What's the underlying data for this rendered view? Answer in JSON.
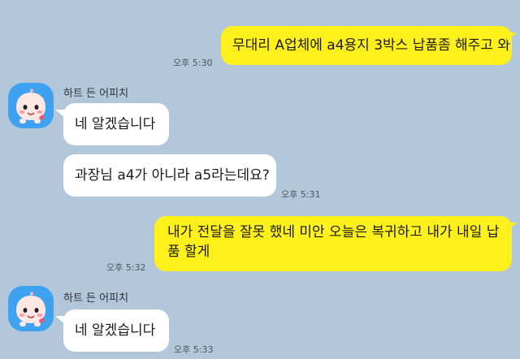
{
  "chat": {
    "messages": [
      {
        "side": "me",
        "text": "무대리 A업체에 a4용지 3박스 납품좀 해주고 와",
        "time": "오후 5:30"
      },
      {
        "side": "them",
        "sender": "하트 든 어피치",
        "avatar_icon": "apeach-character-icon",
        "text": "네 알겠습니다"
      },
      {
        "side": "them",
        "text": "과장님 a4가 아니라 a5라는데요?",
        "time": "오후 5:31"
      },
      {
        "side": "me",
        "text": "내가 전달을 잘못 했네 미안 오늘은 복귀하고 내가 내일 납품 할게",
        "time": "오후 5:32"
      },
      {
        "side": "them",
        "sender": "하트 든 어피치",
        "avatar_icon": "apeach-character-icon",
        "text": "네 알겠습니다",
        "time": "오후 5:33"
      }
    ]
  },
  "colors": {
    "background": "#b2c7d9",
    "my_bubble": "#fef01b",
    "their_bubble": "#ffffff",
    "avatar_bg": "#3ea2f0"
  }
}
